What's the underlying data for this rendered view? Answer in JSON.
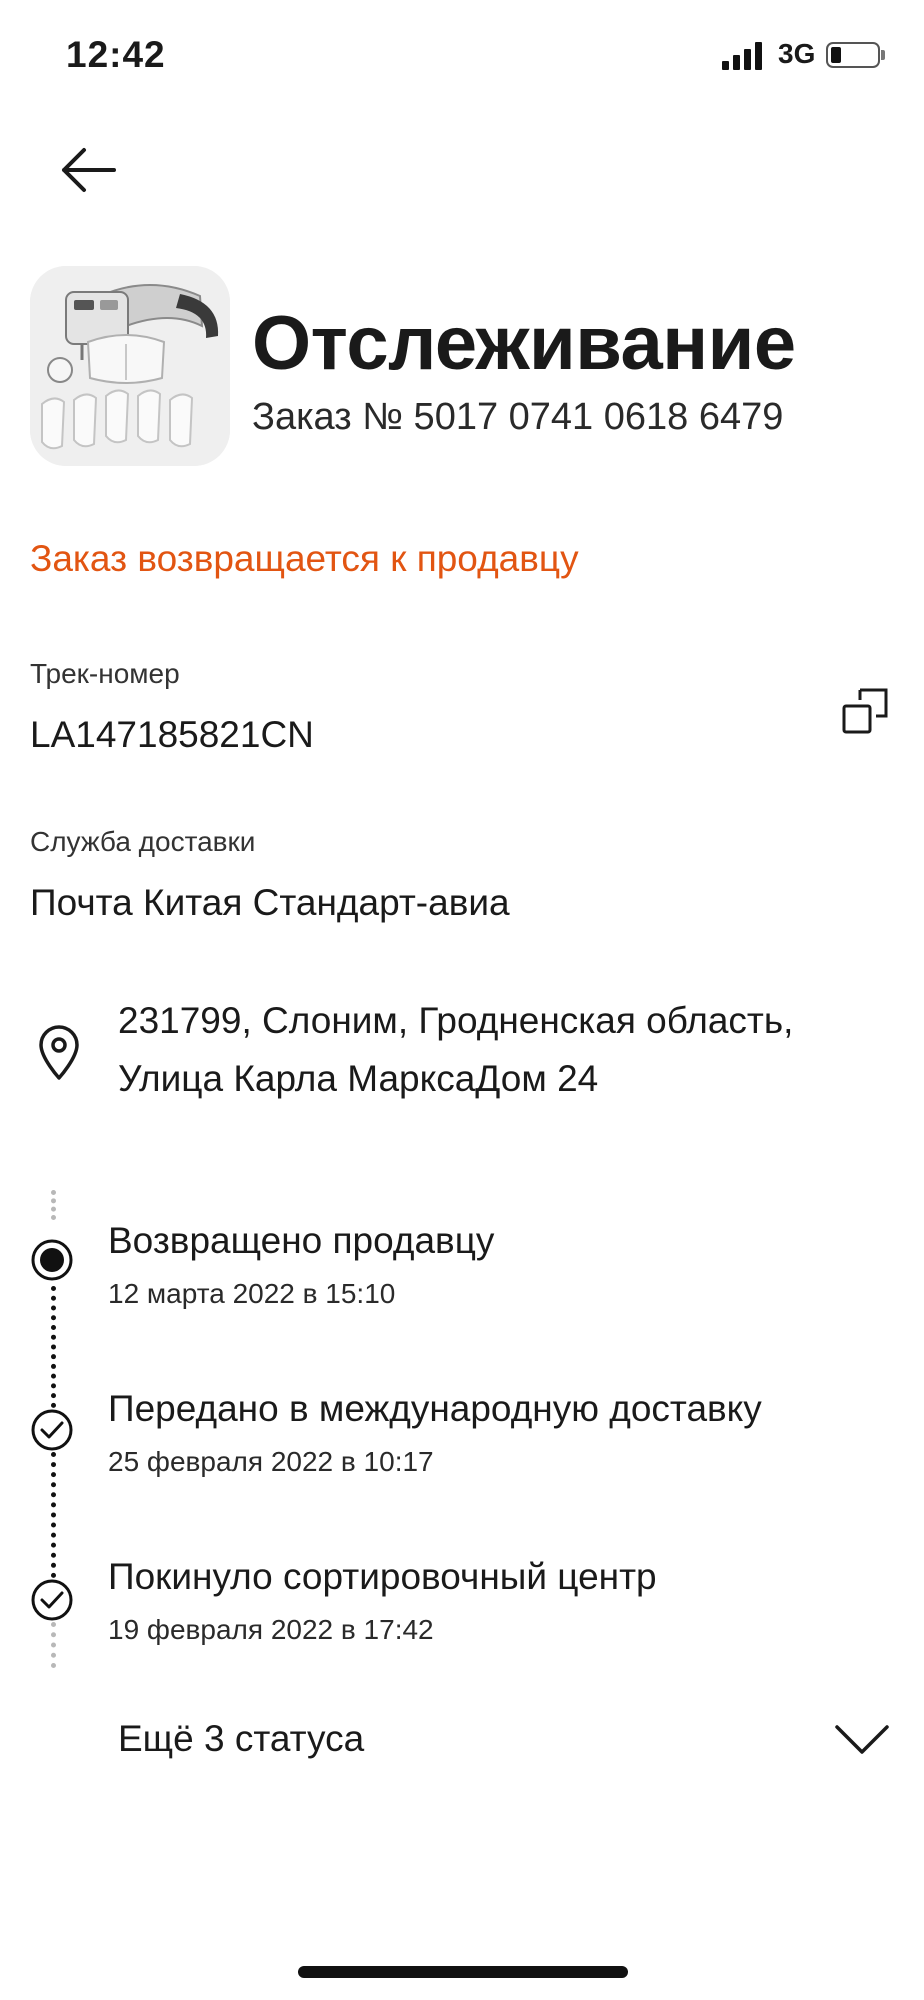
{
  "status_bar": {
    "time": "12:42",
    "network": "3G"
  },
  "header": {
    "title": "Отслеживание",
    "order_number": "Заказ № 5017 0741 0618 6479"
  },
  "order_status": {
    "text": "Заказ возвращается к продавцу",
    "color": "#e25512"
  },
  "tracking": {
    "label": "Трек-номер",
    "value": "LA147185821CN"
  },
  "delivery_service": {
    "label": "Служба доставки",
    "value": "Почта Китая Стандарт-авиа"
  },
  "address": {
    "line1": "231799, Слоним, Гродненская область,",
    "line2": "Улица Карла МарксаДом 24"
  },
  "timeline": [
    {
      "title": "Возвращено продавцу",
      "date": "12 марта 2022 в 15:10",
      "state": "current"
    },
    {
      "title": "Передано в международную доставку",
      "date": "25 февраля 2022 в 10:17",
      "state": "done"
    },
    {
      "title": "Покинуло сортировочный центр",
      "date": "19 февраля 2022 в 17:42",
      "state": "done"
    }
  ],
  "more_statuses": {
    "label": "Ещё 3 статуса"
  },
  "icons": {
    "back": "arrow-left-icon",
    "copy": "copy-icon",
    "address": "map-pin-icon",
    "current_status": "filled-circle-icon",
    "done_status": "check-circle-icon",
    "expand": "chevron-down-icon"
  }
}
